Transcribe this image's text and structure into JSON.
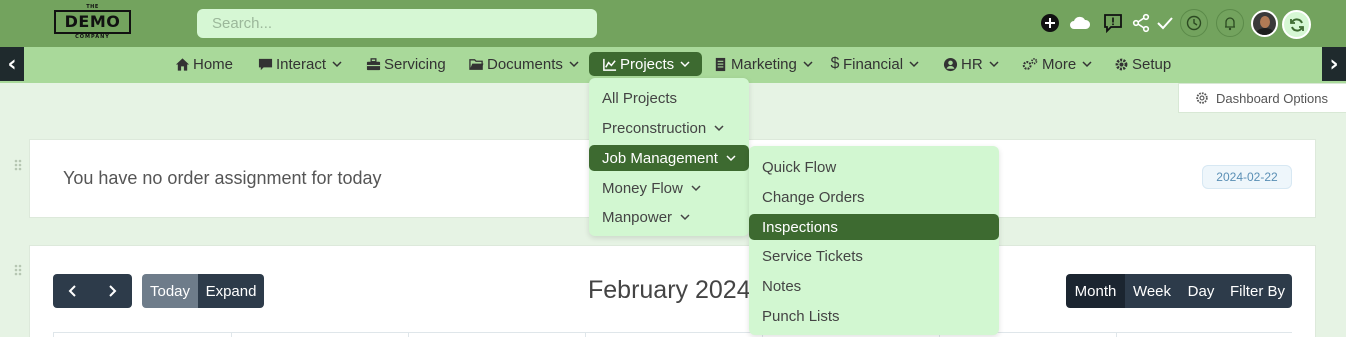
{
  "logo": {
    "line1": "THE",
    "line2": "DEMO",
    "line3": "COMPANY"
  },
  "search": {
    "placeholder": "Search..."
  },
  "topbar_icons": [
    "add-icon",
    "cloud-icon",
    "feedback-icon",
    "share-icon",
    "check-icon",
    "clock-icon",
    "bell-icon",
    "avatar",
    "sync-icon"
  ],
  "nav": {
    "prev": "‹",
    "next": "›",
    "items": [
      {
        "label": "Home",
        "icon": "home-icon"
      },
      {
        "label": "Interact",
        "icon": "comment-icon",
        "dropdown": true
      },
      {
        "label": "Servicing",
        "icon": "toolbox-icon"
      },
      {
        "label": "Documents",
        "icon": "folder-icon",
        "dropdown": true
      },
      {
        "label": "Projects",
        "icon": "chart-icon",
        "dropdown": true,
        "active": true
      },
      {
        "label": "Marketing",
        "icon": "document-icon",
        "dropdown": true
      },
      {
        "label": "Financial",
        "icon": "dollar-icon",
        "dropdown": true
      },
      {
        "label": "HR",
        "icon": "user-circle-icon",
        "dropdown": true
      },
      {
        "label": "More",
        "icon": "cogs-icon",
        "dropdown": true
      },
      {
        "label": "Setup",
        "icon": "gear-icon"
      }
    ]
  },
  "projects_menu": [
    {
      "label": "All Projects"
    },
    {
      "label": "Preconstruction",
      "submenu": true
    },
    {
      "label": "Job Management",
      "submenu": true,
      "active": true
    },
    {
      "label": "Money Flow",
      "submenu": true
    },
    {
      "label": "Manpower",
      "submenu": true
    }
  ],
  "job_management_menu": [
    {
      "label": "Quick Flow"
    },
    {
      "label": "Change Orders"
    },
    {
      "label": "Inspections",
      "active": true
    },
    {
      "label": "Service Tickets"
    },
    {
      "label": "Notes"
    },
    {
      "label": "Punch Lists"
    }
  ],
  "dashboard_options": {
    "label": "Dashboard Options"
  },
  "order_card": {
    "message": "You have no order assignment for today",
    "date": "2024-02-22"
  },
  "calendar": {
    "prev": "prev",
    "next": "next",
    "today_label": "Today",
    "expand_label": "Expand",
    "title": "February 2024",
    "views": [
      "Month",
      "Week",
      "Day"
    ],
    "active_view": "Month",
    "filter_label": "Filter By"
  },
  "colors": {
    "topbar": "#73a35e",
    "navbar": "#a9d99a",
    "active": "#3d6a30",
    "menu_bg": "#d2f7d1",
    "page_bg": "#e6f3e4"
  }
}
